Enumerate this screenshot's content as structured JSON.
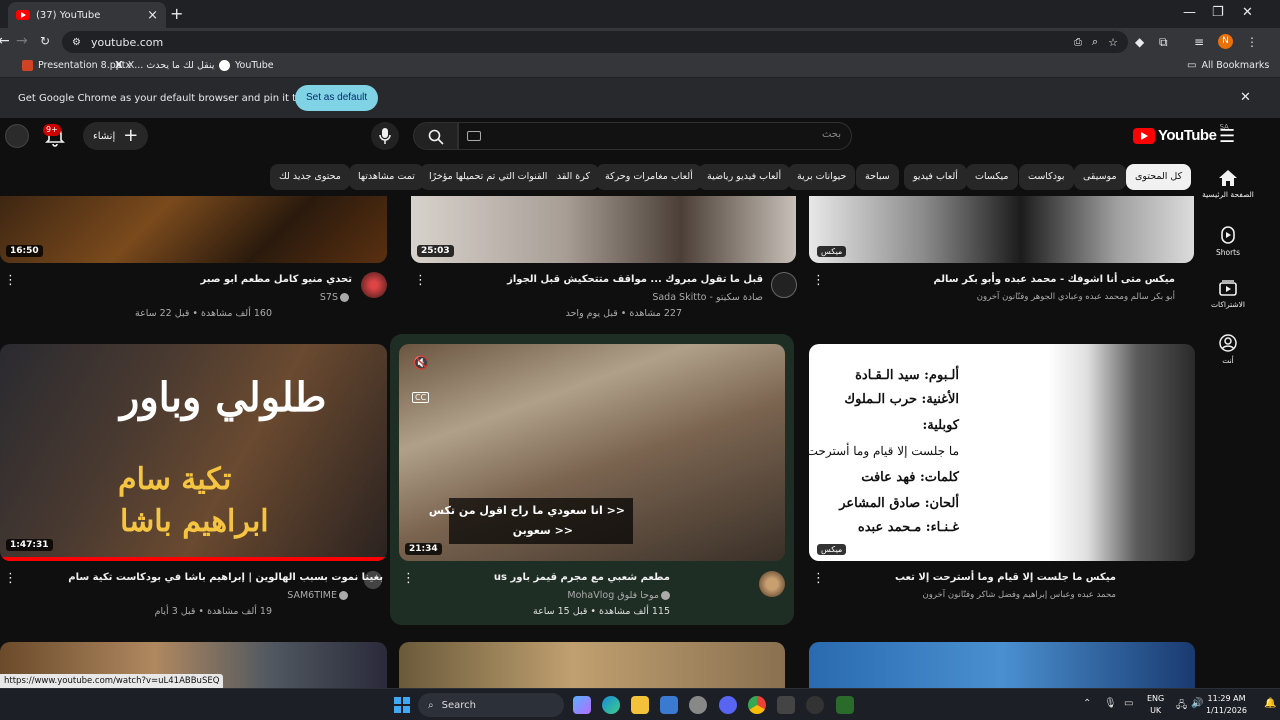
{
  "browser": {
    "tab_title": "(37) YouTube",
    "url": "youtube.com",
    "bookmarks": [
      {
        "label": "Presentation 8.pptx"
      },
      {
        "label": "X... ينقل لك ما يحدث"
      },
      {
        "label": "YouTube"
      }
    ],
    "all_bookmarks": "All Bookmarks",
    "profile_initial": "N",
    "infobar_text": "Get Google Chrome as your default browser and pin it to your taskbar",
    "set_default_label": "Set as default"
  },
  "youtube": {
    "logo_text": "YouTube",
    "country_code": "SA",
    "search_placeholder": "بحث",
    "create_label": "إنشاء",
    "notif_count": "9+",
    "chips": [
      {
        "label": "كل المحتوى",
        "active": true
      },
      {
        "label": "موسيقى"
      },
      {
        "label": "بودكاست"
      },
      {
        "label": "ميكسات"
      },
      {
        "label": "ألعاب فيديو"
      },
      {
        "label": "سباحة"
      },
      {
        "label": "حيوانات برية"
      },
      {
        "label": "ألعاب فيديو رياضية"
      },
      {
        "label": "ألعاب مغامرات وحركة"
      },
      {
        "label": "كرة القدم"
      },
      {
        "label": "القنوات التي تم تحميلها مؤخرًا"
      },
      {
        "label": "تمت مشاهدتها"
      },
      {
        "label": "محتوى جديد لك"
      }
    ],
    "guide": [
      {
        "label": "الصفحة الرئيسية"
      },
      {
        "label": "Shorts"
      },
      {
        "label": "الاشتراكات"
      },
      {
        "label": "أنت"
      }
    ],
    "videos_row1": [
      {
        "duration": "16:50",
        "title": "تحدي منيو كامل مطعم ابو صبر",
        "channel": "S7S",
        "views": "160 ألف مشاهدة",
        "age": "قبل 22 ساعة"
      },
      {
        "duration": "25:03",
        "title": "قبل ما تقول مبروك ... مواقف متتحكيش قبل الجواز",
        "channel": "Sada Skitto - صادة سكيتو",
        "views": "227 مشاهدة",
        "age": "قبل يوم واحد"
      },
      {
        "badge": "ميكس",
        "title": "ميكس متى أنا اشوفك - محمد عبده وأبو بكر سالم",
        "subtitle": "أبو بكر سالم ومحمد عبده وعبادي الجوهر وفنّانون آخرون"
      }
    ],
    "videos_row2": [
      {
        "duration": "1:47:31",
        "title": "بغينا نموت بسبب الهالوين | إبراهيم باشا في بودكاست تكية سام",
        "channel": "SAM6TIME",
        "views": "19 ألف مشاهدة",
        "age": "قبل 3 أيام",
        "thumb_text_1": "طلولي وباور",
        "thumb_text_2": "تكية سام",
        "thumb_text_3": "ابراهيم باشا"
      },
      {
        "duration": "21:34",
        "title": "مطعم شعبي مع مجرم قيمز باور us",
        "channel": "MohaVlog موحا فلوق",
        "views": "115 ألف مشاهدة",
        "age": "قبل 15 ساعة",
        "caption_1": "<< انا سعودي ما راح اقول من تكس",
        "caption_2": "<< سعوبن",
        "cc_label": "CC"
      },
      {
        "badge": "ميكس",
        "title": "ميكس ما جلست إلا قيام وما أسترحت إلا تعب",
        "subtitle": "محمد عبده وعباس إبراهيم وفضل شاكر وفنّانون آخرون",
        "lyrics": [
          "ألـبوم: سيد الـقـادة",
          "الأغنية: حرب الـملوك",
          "كوبلية:",
          "ما جلست إلا قيام وما أسترحت إلا تعب",
          "كلمات: فهد عافت",
          "ألحان: صادق المشاعر",
          "غـنـاء: مـحمد عبده"
        ]
      }
    ],
    "status_url": "https://www.youtube.com/watch?v=uL41ABBuSEQ"
  },
  "taskbar": {
    "search_label": "Search",
    "lang_line1": "ENG",
    "lang_line2": "UK",
    "time": "11:29 AM",
    "date": "1/11/2026"
  },
  "colors": {
    "yt_red": "#ff0000",
    "chip_active": "#f1f1f1",
    "set_default_btn": "#7fd3e5"
  }
}
